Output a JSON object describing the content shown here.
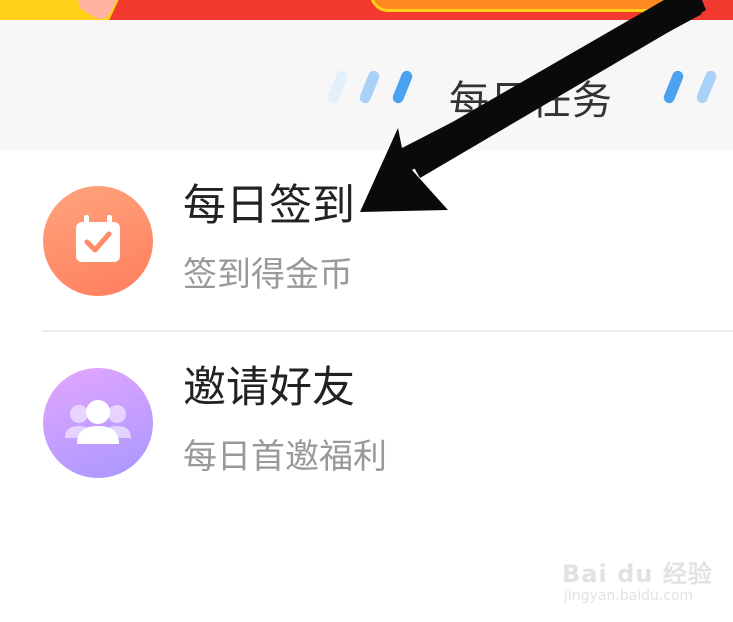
{
  "section": {
    "title": "每日任务"
  },
  "tasks": [
    {
      "title": "每日签到",
      "subtitle": "签到得金币",
      "icon": "calendar-check-icon"
    },
    {
      "title": "邀请好友",
      "subtitle": "每日首邀福利",
      "icon": "users-icon"
    }
  ],
  "watermark": {
    "brand": "Bai du 经验",
    "url": "jingyan.baidu.com"
  },
  "colors": {
    "banner": "#f23b2e",
    "checkin_icon": "#ff8a66",
    "invite_icon": "#c9a0ff",
    "dash_blue": "#4aa2f0"
  }
}
